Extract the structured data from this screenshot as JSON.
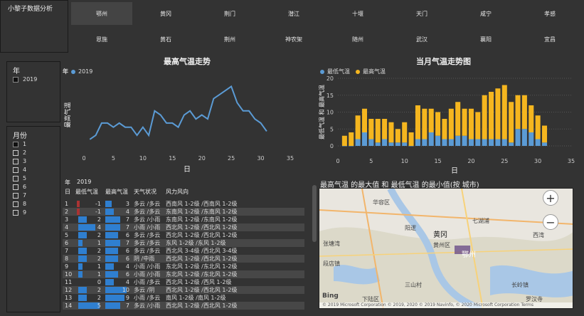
{
  "app_title": "小黎子数据分析",
  "cities": {
    "row1": [
      "鄂州",
      "黄冈",
      "荆门",
      "潜江",
      "十堰",
      "天门",
      "咸宁",
      "孝感"
    ],
    "row2": [
      "恩施",
      "黄石",
      "荆州",
      "神农架",
      "随州",
      "武汉",
      "襄阳",
      "宜昌"
    ],
    "active": "鄂州"
  },
  "year_slicer": {
    "title": "年",
    "items": [
      "2019"
    ]
  },
  "month_slicer": {
    "title": "月份",
    "items": [
      "1",
      "2",
      "3",
      "4",
      "5",
      "6",
      "7",
      "8",
      "9"
    ]
  },
  "line_chart": {
    "title": "最高气温走势",
    "legend_title": "年",
    "legend_item": "2019",
    "xlabel": "日",
    "ylabel": "最高气温",
    "x_ticks": [
      "0",
      "5",
      "10",
      "15",
      "20",
      "25",
      "30",
      "35"
    ]
  },
  "bar_chart": {
    "title": "当月气温走势图",
    "legend_low": "最低气温",
    "legend_high": "最高气温",
    "xlabel": "日",
    "ylabel": "最低气温 和 最高气温",
    "x_ticks": [
      "0",
      "5",
      "10",
      "15",
      "20",
      "25",
      "30",
      "35"
    ],
    "y_ticks": [
      "0",
      "5",
      "10",
      "15",
      "20"
    ]
  },
  "chart_data": [
    {
      "type": "line",
      "title": "最高气温走势",
      "xlabel": "日",
      "ylabel": "最高气温",
      "xlim": [
        0,
        35
      ],
      "ylim": [
        0,
        18
      ],
      "series": [
        {
          "name": "2019",
          "x": [
            1,
            2,
            3,
            4,
            5,
            6,
            7,
            8,
            9,
            10,
            11,
            12,
            13,
            14,
            15,
            16,
            17,
            18,
            19,
            20,
            21,
            22,
            23,
            24,
            25,
            26,
            27,
            28,
            29,
            30,
            31
          ],
          "values": [
            3,
            4,
            7,
            7,
            6,
            7,
            6,
            6,
            4,
            6,
            4,
            10,
            9,
            7,
            7,
            6,
            9,
            10,
            8,
            9,
            8,
            13,
            14,
            15,
            16,
            12,
            10,
            10,
            8,
            7,
            5
          ]
        }
      ],
      "color": "#5b9bd5"
    },
    {
      "type": "bar",
      "title": "当月气温走势图",
      "xlabel": "日",
      "ylabel": "最低气温 和 最高气温",
      "xlim": [
        0,
        35
      ],
      "ylim": [
        0,
        20
      ],
      "x": [
        1,
        2,
        3,
        4,
        5,
        6,
        7,
        8,
        9,
        10,
        11,
        12,
        13,
        14,
        15,
        16,
        17,
        18,
        19,
        20,
        21,
        22,
        23,
        24,
        25,
        26,
        27,
        28,
        29,
        30,
        31
      ],
      "series": [
        {
          "name": "最低气温",
          "values": [
            -1,
            -1,
            2,
            4,
            2,
            1,
            2,
            1,
            1,
            1,
            0,
            2,
            2,
            4,
            3,
            2,
            2,
            3,
            3,
            2,
            2,
            2,
            2,
            2,
            2,
            1,
            5,
            5,
            4,
            2,
            1
          ],
          "color": "#5b9bd5"
        },
        {
          "name": "最高气温",
          "values": [
            3,
            4,
            7,
            7,
            6,
            7,
            6,
            6,
            4,
            6,
            4,
            10,
            9,
            7,
            7,
            6,
            9,
            10,
            8,
            9,
            8,
            13,
            14,
            15,
            16,
            12,
            10,
            10,
            8,
            7,
            5
          ],
          "color": "#f5b61f"
        }
      ]
    }
  ],
  "table": {
    "year_label": "年",
    "year_value": "2019",
    "columns": [
      "日",
      "最低气温",
      "最高气温",
      "天气状况",
      "风力风向"
    ],
    "rows": [
      {
        "day": "1",
        "low": "-1",
        "high": "3",
        "weather": "多云 /多云",
        "wind": "西南风 1-2级 /西南风 1-2级"
      },
      {
        "day": "2",
        "low": "-1",
        "high": "4",
        "weather": "多云 /多云",
        "wind": "东南风 1-2级 /东南风 1-2级"
      },
      {
        "day": "3",
        "low": "2",
        "high": "7",
        "weather": "多云 /小雨",
        "wind": "东南风 1-2级 /东南风 1-2级"
      },
      {
        "day": "4",
        "low": "4",
        "high": "7",
        "weather": "小雨 /小雨",
        "wind": "西北风 1-2级 /西北风 1-2级"
      },
      {
        "day": "5",
        "low": "2",
        "high": "6",
        "weather": "多云 /多云",
        "wind": "西北风 1-2级 /西北风 1-2级"
      },
      {
        "day": "6",
        "low": "1",
        "high": "7",
        "weather": "多云 /多云",
        "wind": "东风 1-2级 /东风 1-2级"
      },
      {
        "day": "7",
        "low": "2",
        "high": "6",
        "weather": "多云 /多云",
        "wind": "西北风 3-4级 /西北风 3-4级"
      },
      {
        "day": "8",
        "low": "2",
        "high": "6",
        "weather": "阴 /中雨",
        "wind": "西北风 1-2级 /西北风 1-2级"
      },
      {
        "day": "9",
        "low": "1",
        "high": "4",
        "weather": "小雨 /小雨",
        "wind": "东北风 1-2级 /东北风 1-2级"
      },
      {
        "day": "10",
        "low": "1",
        "high": "6",
        "weather": "小雨 /小雨",
        "wind": "东北风 1-2级 /东北风 1-2级"
      },
      {
        "day": "11",
        "low": "0",
        "high": "4",
        "weather": "小雨 /多云",
        "wind": "西北风 1-2级 /西风 1-2级"
      },
      {
        "day": "12",
        "low": "2",
        "high": "10",
        "weather": "多云 /阴",
        "wind": "西北风 1-2级 /西北风 1-2级"
      },
      {
        "day": "13",
        "low": "2",
        "high": "9",
        "weather": "小雨 /多云",
        "wind": "南风 1-2级 /南风 1-2级"
      },
      {
        "day": "14",
        "low": "5",
        "high": "7",
        "weather": "多云 /小雨",
        "wind": "西北风 1-2级 /西北风 1-2级"
      }
    ]
  },
  "map": {
    "title": "最高气温 的最大值 和 最低气温 的最小值(按 城市)",
    "labels": [
      "华容区",
      "黄冈",
      "黄州区",
      "鄂州",
      "下陆区",
      "三山村",
      "七湖浦",
      "段店镇",
      "阳逻",
      "长岭镇",
      "张塘湾",
      "西湾",
      "罗汉寺"
    ],
    "bing": "Bing",
    "footer": "© 2019 Microsoft Corporation  © 2019, 2020  © 2019 Navinfo, © 2020 Microsoft Corporation  Terms"
  }
}
